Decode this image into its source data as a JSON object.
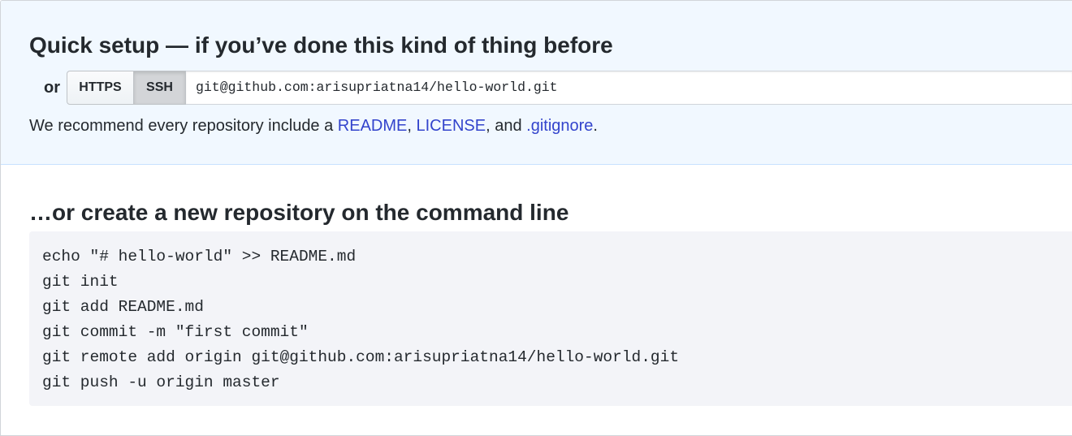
{
  "quick_setup": {
    "title": "Quick setup — if you’ve done this kind of thing before",
    "or_label": "or",
    "protocols": [
      {
        "label": "HTTPS",
        "selected": false
      },
      {
        "label": "SSH",
        "selected": true
      }
    ],
    "clone_url": "git@github.com:arisupriatna14/hello-world.git",
    "recommend": {
      "prefix": "We recommend every repository include a ",
      "readme": "README",
      "sep1": ", ",
      "license": "LICENSE",
      "sep2": ", and ",
      "gitignore": ".gitignore",
      "suffix": "."
    },
    "colors": {
      "background": "#f1f8ff",
      "link": "#3344cc"
    }
  },
  "command_line": {
    "title": "…or create a new repository on the command line",
    "lines": [
      "echo \"# hello-world\" >> README.md",
      "git init",
      "git add README.md",
      "git commit -m \"first commit\"",
      "git remote add origin git@github.com:arisupriatna14/hello-world.git",
      "git push -u origin master"
    ]
  }
}
